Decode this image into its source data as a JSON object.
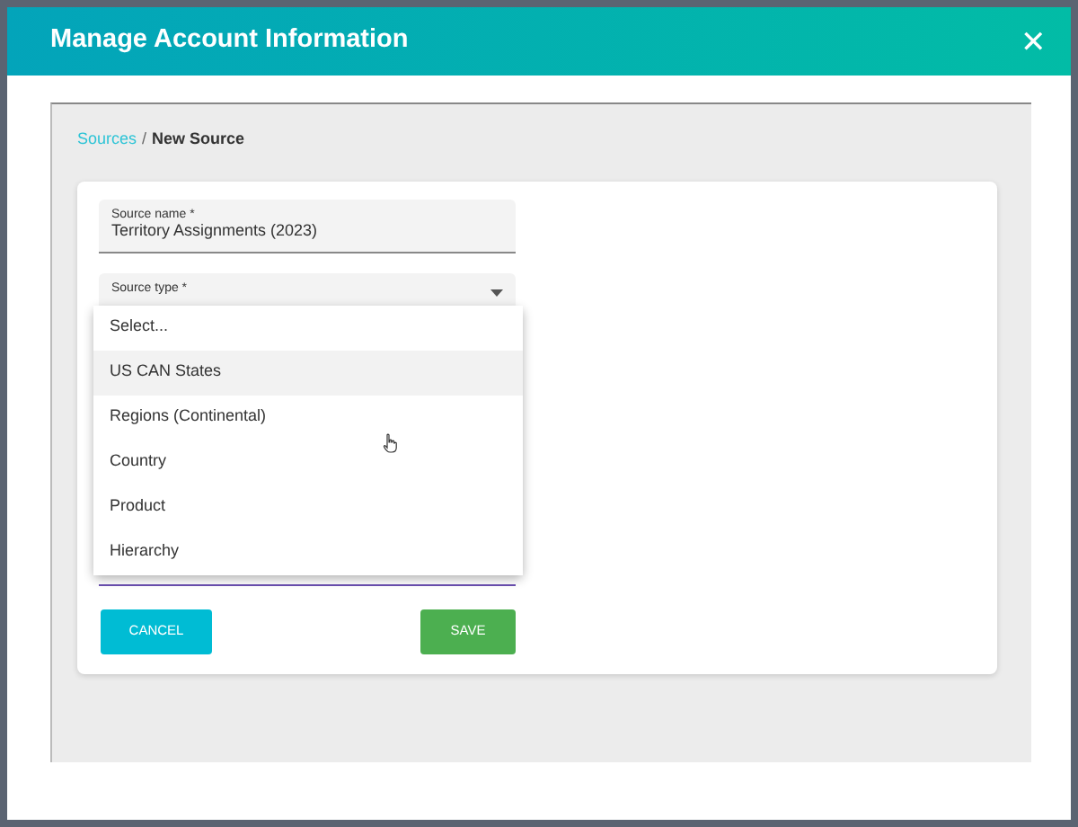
{
  "modal": {
    "title": "Manage Account Information",
    "close": "✕"
  },
  "breadcrumb": [
    {
      "label": "Sources",
      "link": true
    },
    {
      "label": "/",
      "link": false
    },
    {
      "label": "New Source",
      "link": false
    }
  ],
  "fields": [
    {
      "label": "Source name *",
      "value": "Territory Assignments (2023)",
      "kind": "text"
    },
    {
      "label": "Source type *",
      "kind": "select",
      "expanded": true
    }
  ],
  "menu": [
    {
      "label": "Select...",
      "highlighted": false
    },
    {
      "label": "US CAN States",
      "highlighted": true
    },
    {
      "label": "Regions (Continental)",
      "highlighted": false
    },
    {
      "label": "Country",
      "highlighted": false
    },
    {
      "label": "Product",
      "highlighted": false
    },
    {
      "label": "Hierarchy",
      "highlighted": false
    }
  ],
  "buttons": [
    {
      "label": "CANCEL",
      "kind": "cancel"
    },
    {
      "label": "SAVE",
      "kind": "save"
    }
  ]
}
